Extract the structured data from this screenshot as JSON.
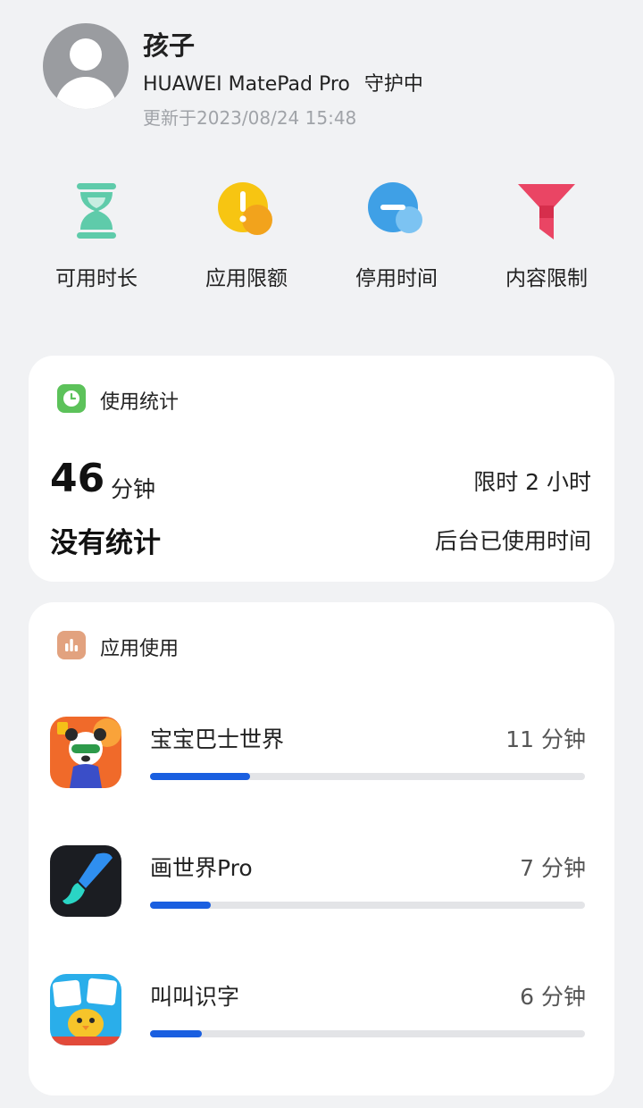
{
  "profile": {
    "name": "孩子",
    "device": "HUAWEI MatePad Pro",
    "status": "守护中",
    "updated": "更新于2023/08/24 15:48"
  },
  "features": [
    {
      "label": "可用时长",
      "icon": "hourglass-icon"
    },
    {
      "label": "应用限额",
      "icon": "app-limit-icon"
    },
    {
      "label": "停用时间",
      "icon": "downtime-icon"
    },
    {
      "label": "内容限制",
      "icon": "content-filter-icon"
    }
  ],
  "usage": {
    "title": "使用统计",
    "minutes": "46",
    "unit": "分钟",
    "limit": "限时 2 小时",
    "no_stats": "没有统计",
    "background_label": "后台已使用时间"
  },
  "app_usage": {
    "title": "应用使用",
    "apps": [
      {
        "name": "宝宝巴士世界",
        "time": "11 分钟",
        "progress": 0.23
      },
      {
        "name": "画世界Pro",
        "time": "7 分钟",
        "progress": 0.14
      },
      {
        "name": "叫叫识字",
        "time": "6 分钟",
        "progress": 0.12
      }
    ]
  },
  "colors": {
    "accent_blue": "#1a5fe0",
    "usage_icon_green": "#5cc25a",
    "app_icon_tan": "#e2a27f"
  }
}
